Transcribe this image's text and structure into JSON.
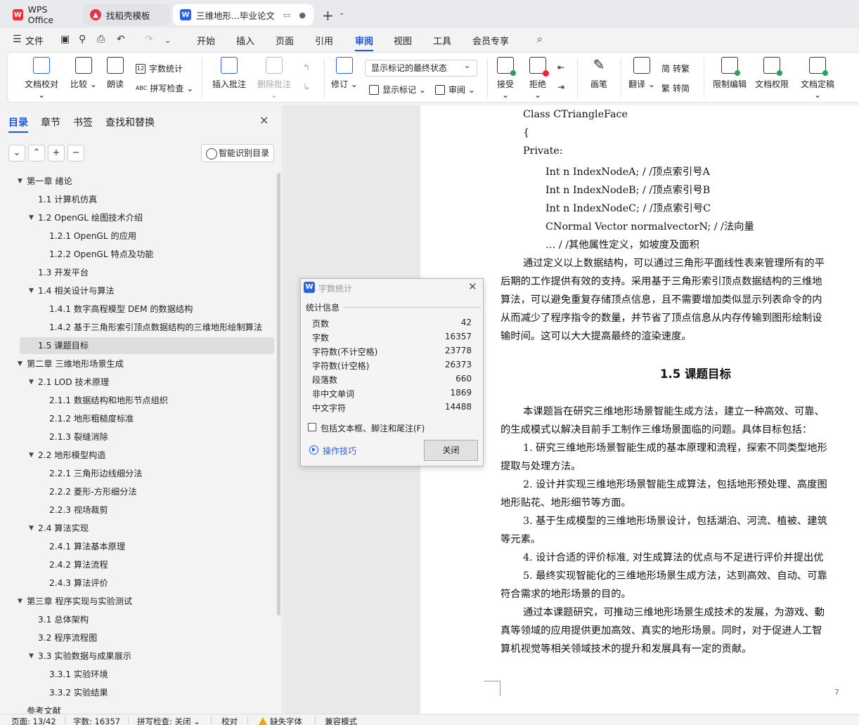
{
  "tabs": {
    "wps": "WPS Office",
    "daoke": "找稻壳模板",
    "doc": "三维地形...毕业论文",
    "wps_icon": "W",
    "doc_icon": "W"
  },
  "menu": {
    "file": "文件",
    "items": [
      "开始",
      "插入",
      "页面",
      "引用",
      "审阅",
      "视图",
      "工具",
      "会员专享"
    ],
    "active": "审阅"
  },
  "ribbon": {
    "doc_check": "文档校对",
    "compare": "比较",
    "read_aloud": "朗读",
    "word_count": "字数统计",
    "word_count_icon": "12",
    "spell_check": "拼写检查",
    "spell_icon": "ABC",
    "insert_comment": "插入批注",
    "delete_comment": "删除批注",
    "revise": "修订",
    "display_state": "显示标记的最终状态",
    "show_markup": "显示标记",
    "review": "审阅",
    "accept": "接受",
    "reject": "拒绝",
    "draw": "画笔",
    "translate": "翻译",
    "to_traditional": "转繁",
    "to_simplified": "转简",
    "restrict_edit": "限制编辑",
    "doc_permission": "文档权限",
    "doc_finalize": "文档定稿"
  },
  "nav": {
    "tabs": [
      "目录",
      "章节",
      "书签",
      "查找和替换"
    ],
    "active_tab": "目录",
    "smart_toc": "智能识别目录",
    "toc": [
      {
        "label": "第一章  绪论",
        "level": 0,
        "expanded": true
      },
      {
        "label": "1.1  计算机仿真",
        "level": 1
      },
      {
        "label": "1.2 OpenGL 绘图技术介绍",
        "level": 1,
        "expanded": true
      },
      {
        "label": "1.2.1 OpenGL 的应用",
        "level": 2
      },
      {
        "label": "1.2.2 OpenGL 特点及功能",
        "level": 2
      },
      {
        "label": "1.3  开发平台",
        "level": 1
      },
      {
        "label": "1.4  相关设计与算法",
        "level": 1,
        "expanded": true
      },
      {
        "label": "1.4.1  数字高程模型 DEM 的数据结构",
        "level": 2
      },
      {
        "label": "1.4.2  基于三角形索引顶点数据结构的三维地形绘制算法",
        "level": 2
      },
      {
        "label": "1.5  课题目标",
        "level": 1,
        "selected": true
      },
      {
        "label": "第二章  三维地形场景生成",
        "level": 0,
        "expanded": true
      },
      {
        "label": "2.1 LOD 技术原理",
        "level": 1,
        "expanded": true
      },
      {
        "label": "2.1.1  数据结构和地形节点组织",
        "level": 2
      },
      {
        "label": "2.1.2  地形粗糙度标准",
        "level": 2
      },
      {
        "label": "2.1.3  裂缝消除",
        "level": 2
      },
      {
        "label": "2.2  地形模型构造",
        "level": 1,
        "expanded": true
      },
      {
        "label": "2.2.1  三角形边线细分法",
        "level": 2
      },
      {
        "label": "2.2.2  菱形-方形细分法",
        "level": 2
      },
      {
        "label": "2.2.3  视场裁剪",
        "level": 2
      },
      {
        "label": "2.4  算法实现",
        "level": 1,
        "expanded": true
      },
      {
        "label": "2.4.1  算法基本原理",
        "level": 2
      },
      {
        "label": "2.4.2  算法流程",
        "level": 2
      },
      {
        "label": "2.4.3  算法评价",
        "level": 2
      },
      {
        "label": "第三章  程序实现与实验测试",
        "level": 0,
        "expanded": true
      },
      {
        "label": "3.1  总体架构",
        "level": 1
      },
      {
        "label": "3.2  程序流程图",
        "level": 1
      },
      {
        "label": "3.3  实验数据与成果展示",
        "level": 1,
        "expanded": true
      },
      {
        "label": "3.3.1  实验环境",
        "level": 2
      },
      {
        "label": "3.3.2  实验结果",
        "level": 2
      },
      {
        "label": "参考文献",
        "level": 0
      }
    ]
  },
  "document": {
    "code_lines": [
      "Class CTriangleFace",
      "{",
      "Private:",
      "Int n IndexNodeA; / /顶点索引号A",
      "Int n IndexNodeB; / /顶点索引号B",
      "Int n IndexNodeC; / /顶点索引号C",
      "CNormal Vector normalvectorN; / /法向量",
      "… / /其他属性定义，如坡度及面积"
    ],
    "para1": [
      "通过定义以上数据结构，可以通过三角形平面线性表来管理所有的平",
      "后期的工作提供有效的支持。采用基于三角形索引顶点数据结构的三维地",
      "算法，可以避免重复存储顶点信息，且不需要增加类似显示列表命令的内",
      "从而减少了程序指令的数量，并节省了顶点信息从内存传输到图形绘制设",
      "输时间。这可以大大提高最终的渲染速度。"
    ],
    "heading": "1.5  课题目标",
    "para2": [
      "本课题旨在研究三维地形场景智能生成方法，建立一种高效、可靠、",
      "的生成模式以解决目前手工制作三维场景面临的问题。具体目标包括：",
      "1. 研究三维地形场景智能生成的基本原理和流程，探索不同类型地形",
      "提取与处理方法。",
      "2. 设计并实现三维地形场景智能生成算法，包括地形预处理、高度图",
      "地形贴花、地形细节等方面。",
      "3. 基于生成模型的三维地形场景设计，包括湖泊、河流、植被、建筑",
      "等元素。",
      "4. 设计合适的评价标准, 对生成算法的优点与不足进行评价并提出优",
      "5. 最终实现智能化的三维地形场景生成方法，达到高效、自动、可靠",
      "符合需求的地形场景的目的。",
      "通过本课题研究，可推动三维地形场景生成技术的发展，为游戏、動",
      "真等领域的应用提供更加高效、真实的地形场景。同时，对于促进人工智",
      "算机视觉等相关领域技术的提升和发展具有一定的贡献。"
    ],
    "page_number": "7"
  },
  "dialog": {
    "title": "字数统计",
    "icon": "W",
    "section": "统计信息",
    "stats": [
      {
        "label": "页数",
        "value": "42"
      },
      {
        "label": "字数",
        "value": "16357"
      },
      {
        "label": "字符数(不计空格)",
        "value": "23778"
      },
      {
        "label": "字符数(计空格)",
        "value": "26373"
      },
      {
        "label": "段落数",
        "value": "660"
      },
      {
        "label": "非中文单词",
        "value": "1869"
      },
      {
        "label": "中文字符",
        "value": "14488"
      }
    ],
    "include_label": "包括文本框、脚注和尾注(F)",
    "tips": "操作技巧",
    "close": "关闭"
  },
  "status": {
    "page": "页面: 13/42",
    "words": "字数: 16357",
    "spell": "拼写检查: 关闭",
    "proof": "校对",
    "missing_font": "缺失字体",
    "compat": "兼容模式"
  }
}
